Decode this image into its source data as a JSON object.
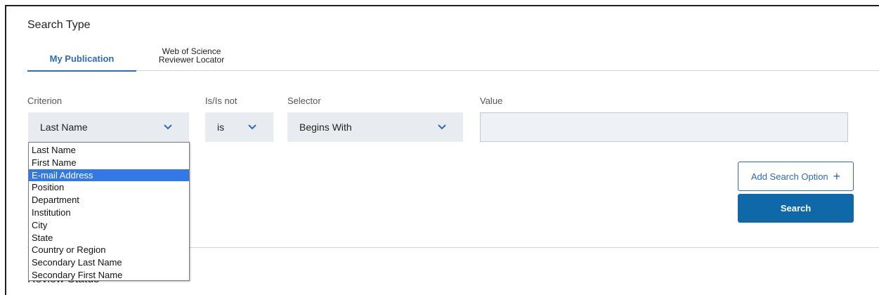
{
  "search_type": {
    "title": "Search Type",
    "tabs": [
      {
        "label": "My Publication",
        "active": true
      },
      {
        "label_line1": "Web of Science",
        "label_line2": "Reviewer Locator",
        "active": false
      }
    ]
  },
  "filters": {
    "criterion": {
      "label": "Criterion",
      "value": "Last Name"
    },
    "is_not": {
      "label": "Is/Is not",
      "value": "is"
    },
    "selector": {
      "label": "Selector",
      "value": "Begins With"
    },
    "value_field": {
      "label": "Value",
      "value": ""
    }
  },
  "criterion_options": [
    "Last Name",
    "First Name",
    "E-mail Address",
    "Position",
    "Department",
    "Institution",
    "City",
    "State",
    "Country or Region",
    "Secondary Last Name",
    "Secondary First Name"
  ],
  "highlighted_option_index": 2,
  "buttons": {
    "add_search_option": "Add Search Option",
    "add_icon": "+",
    "search": "Search"
  },
  "next_section": {
    "title": "Review Status"
  },
  "colors": {
    "accent": "#2e6bb8",
    "primary_button": "#0f68a8",
    "highlight": "#3279e6",
    "select_bg": "#e8ecf1"
  }
}
